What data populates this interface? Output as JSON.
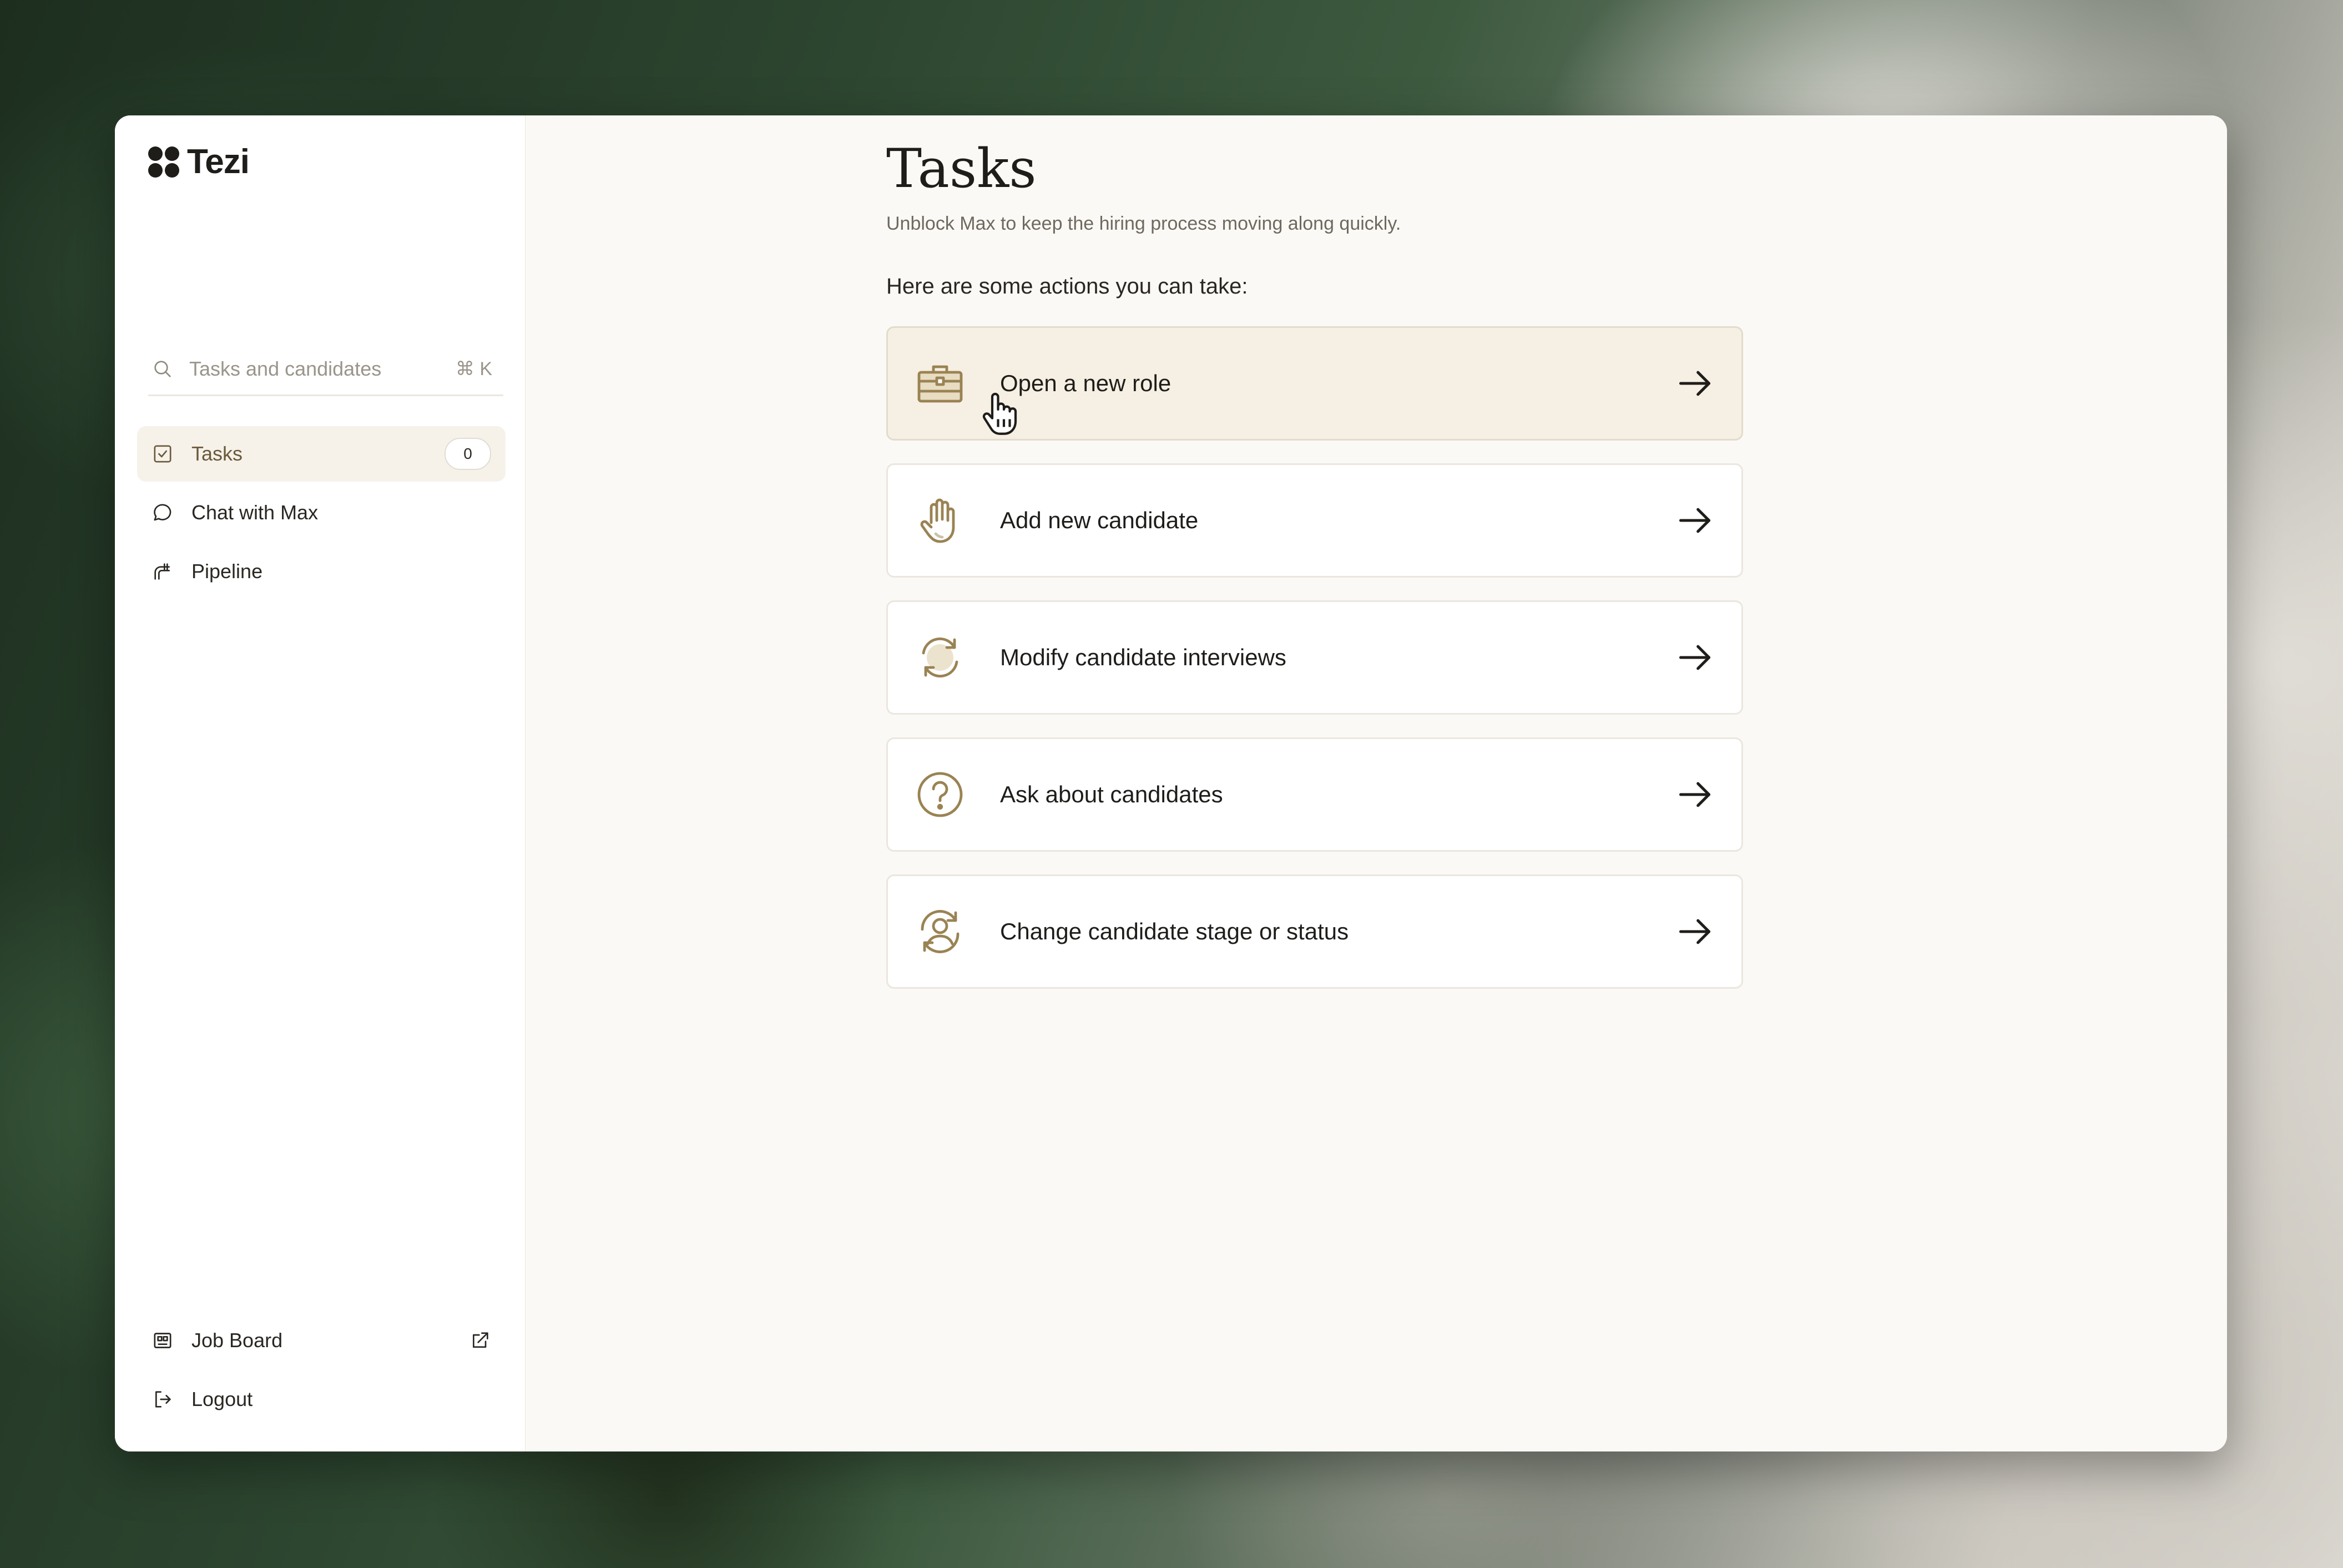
{
  "app": {
    "name": "Tezi"
  },
  "search": {
    "placeholder": "Tasks and candidates",
    "shortcut": "⌘ K"
  },
  "sidebar": {
    "items": [
      {
        "label": "Tasks",
        "icon": "checkbox-icon",
        "active": true,
        "count": "0"
      },
      {
        "label": "Chat with Max",
        "icon": "chat-bubble-icon",
        "active": false
      },
      {
        "label": "Pipeline",
        "icon": "pipeline-icon",
        "active": false
      }
    ],
    "bottom": [
      {
        "label": "Job Board",
        "icon": "job-board-icon",
        "external": true
      },
      {
        "label": "Logout",
        "icon": "logout-icon"
      }
    ]
  },
  "main": {
    "title": "Tasks",
    "subtitle": "Unblock Max to keep the hiring process moving along quickly.",
    "prompt": "Here are some actions you can take:",
    "actions": [
      {
        "label": "Open a new role",
        "icon": "briefcase-icon",
        "hovered": true
      },
      {
        "label": "Add new candidate",
        "icon": "raised-hand-icon"
      },
      {
        "label": "Modify candidate interviews",
        "icon": "refresh-arrows-icon"
      },
      {
        "label": "Ask about candidates",
        "icon": "question-circle-icon"
      },
      {
        "label": "Change candidate stage or status",
        "icon": "user-cycle-icon"
      }
    ]
  },
  "colors": {
    "accent": "#9a8353",
    "hover_bg": "#f6efe3",
    "active_nav_bg": "#f6f2ea",
    "text": "#1f1d1a"
  }
}
